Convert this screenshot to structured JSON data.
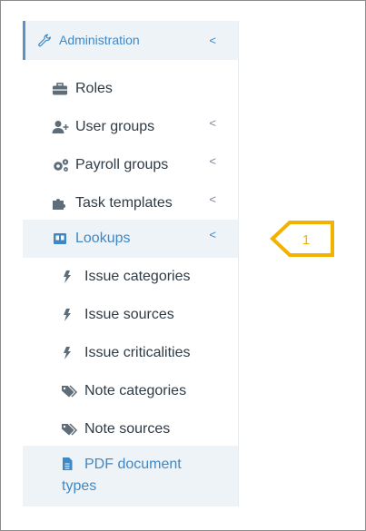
{
  "sidebar": {
    "header": {
      "label": "Administration",
      "icon": "wrench-icon"
    },
    "items": [
      {
        "label": "Roles",
        "icon": "briefcase-icon",
        "has_chevron": false
      },
      {
        "label": "User groups",
        "icon": "user-plus-icon",
        "has_chevron": true
      },
      {
        "label": "Payroll groups",
        "icon": "gears-icon",
        "has_chevron": true
      },
      {
        "label": "Task templates",
        "icon": "puzzle-icon",
        "has_chevron": true
      },
      {
        "label": "Lookups",
        "icon": "book-icon",
        "has_chevron": true,
        "active": true
      }
    ],
    "subitems": [
      {
        "label": "Issue categories",
        "icon": "bolt-icon"
      },
      {
        "label": "Issue sources",
        "icon": "bolt-icon"
      },
      {
        "label": "Issue criticalities",
        "icon": "bolt-icon"
      },
      {
        "label": "Note categories",
        "icon": "tags-icon"
      },
      {
        "label": "Note sources",
        "icon": "tags-icon"
      },
      {
        "label_line1": "PDF document",
        "label_line2": "types",
        "icon": "file-icon",
        "selected": true
      }
    ]
  },
  "callout": {
    "number": "1",
    "color": "#f3b200"
  },
  "colors": {
    "accent": "#3f88c5",
    "active_bg": "#eef3f8",
    "text": "#2f3b45"
  }
}
